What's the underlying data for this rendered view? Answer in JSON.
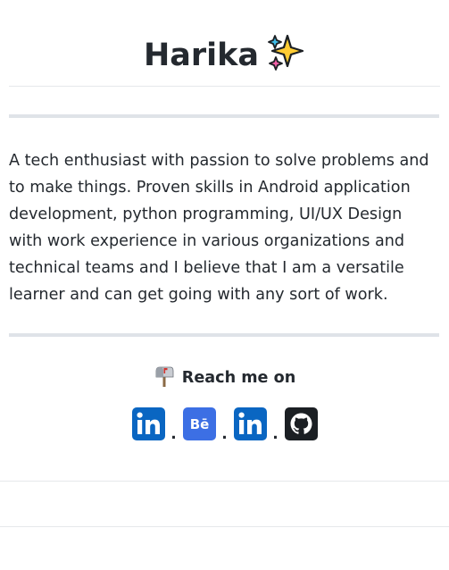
{
  "profile": {
    "name": "Harika",
    "title_emoji": "sparkles-icon"
  },
  "bio": {
    "text": "A tech enthusiast with passion to solve problems and to make things. Proven skills in Android application development, python programming, UI/UX Design with work experience in various organizations and technical teams and I believe that I am a versatile learner and can get going with any sort of work."
  },
  "contact": {
    "heading": "Reach me on",
    "heading_icon": "mailbox-icon",
    "separator": ".",
    "links": [
      {
        "icon": "linkedin-icon",
        "color": "#0a66c2"
      },
      {
        "icon": "behance-icon",
        "color": "#3c6fe4"
      },
      {
        "icon": "linkedin-icon",
        "color": "#0a66c2"
      },
      {
        "icon": "github-icon",
        "color": "#1b1f23"
      }
    ]
  }
}
